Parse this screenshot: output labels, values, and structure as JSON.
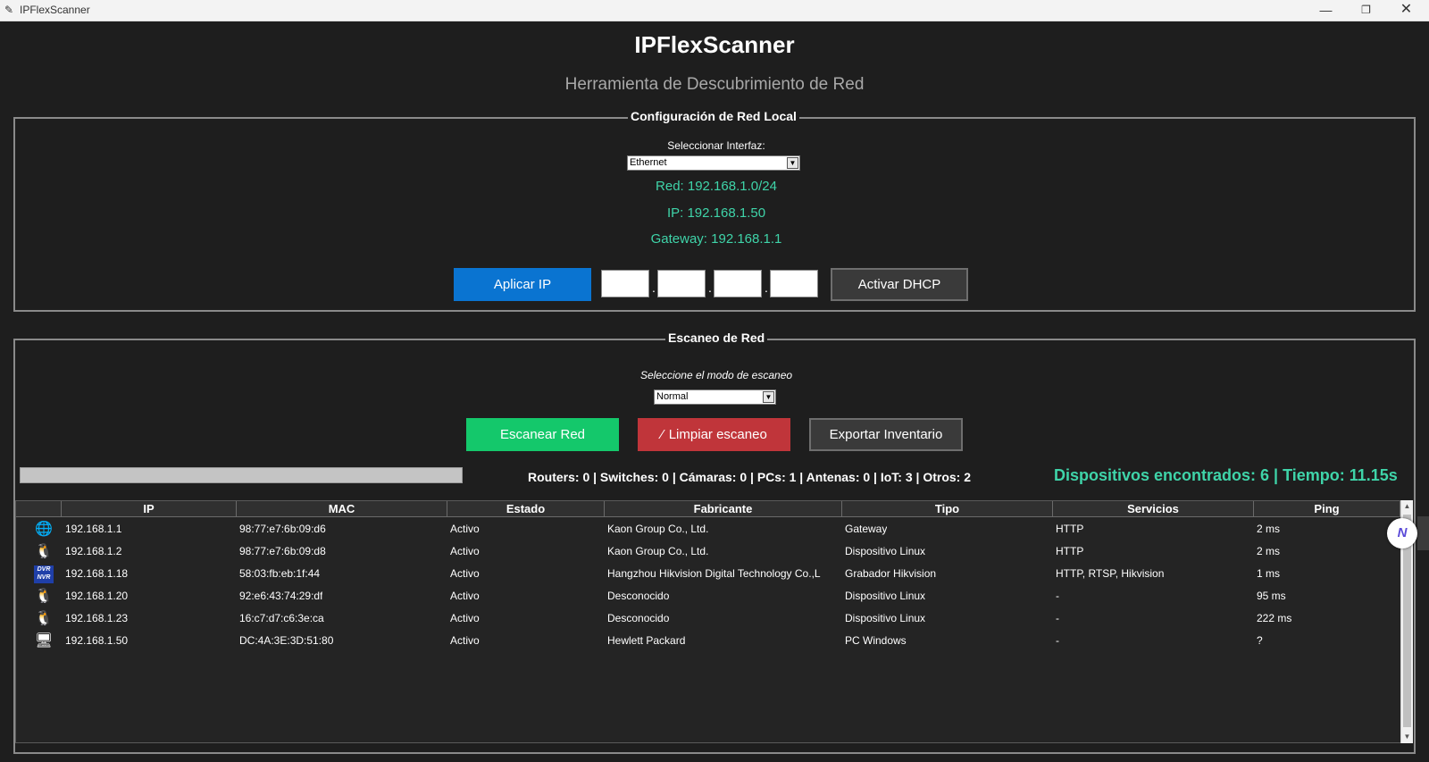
{
  "window": {
    "title": "IPFlexScanner",
    "controls": {
      "minimize": "—",
      "maximize": "❐",
      "close": "✕"
    }
  },
  "header": {
    "title": "IPFlexScanner",
    "subtitle": "Herramienta de Descubrimiento de Red"
  },
  "config": {
    "legend": "Configuración de Red Local",
    "interface_label": "Seleccionar Interfaz:",
    "interface_value": "Ethernet",
    "network": "Red: 192.168.1.0/24",
    "ip": "IP: 192.168.1.50",
    "gateway": "Gateway: 192.168.1.1",
    "apply_ip_label": "Aplicar IP",
    "ip_octets": [
      "",
      "",
      "",
      ""
    ],
    "dhcp_label": "Activar DHCP"
  },
  "scan": {
    "legend": "Escaneo de Red",
    "mode_label": "Seleccione el modo de escaneo",
    "mode_value": "Normal",
    "scan_label": "Escanear Red",
    "clear_label": "Limpiar escaneo",
    "export_label": "Exportar Inventario",
    "counts": "Routers: 0 | Switches: 0 | Cámaras: 0 | PCs: 1 | Antenas: 0 | IoT: 3 | Otros: 2",
    "found": "Dispositivos encontrados: 6 | Tiempo: 11.15s"
  },
  "table": {
    "columns": [
      "",
      "IP",
      "MAC",
      "Estado",
      "Fabricante",
      "Tipo",
      "Servicios",
      "Ping"
    ],
    "rows": [
      {
        "icon": "globe-icon",
        "ip": "192.168.1.1",
        "mac": "98:77:e7:6b:09:d6",
        "estado": "Activo",
        "fabricante": "Kaon Group Co., Ltd.",
        "tipo": "Gateway",
        "servicios": "HTTP",
        "ping": "2 ms"
      },
      {
        "icon": "linux-icon",
        "ip": "192.168.1.2",
        "mac": "98:77:e7:6b:09:d8",
        "estado": "Activo",
        "fabricante": "Kaon Group Co., Ltd.",
        "tipo": "Dispositivo Linux",
        "servicios": "HTTP",
        "ping": "2 ms"
      },
      {
        "icon": "dvr-nvr-icon",
        "ip": "192.168.1.18",
        "mac": "58:03:fb:eb:1f:44",
        "estado": "Activo",
        "fabricante": "Hangzhou Hikvision Digital Technology Co.,L",
        "tipo": "Grabador Hikvision",
        "servicios": "HTTP, RTSP, Hikvision",
        "ping": "1 ms"
      },
      {
        "icon": "linux-icon",
        "ip": "192.168.1.20",
        "mac": "92:e6:43:74:29:df",
        "estado": "Activo",
        "fabricante": "Desconocido",
        "tipo": "Dispositivo Linux",
        "servicios": "-",
        "ping": "95 ms"
      },
      {
        "icon": "linux-icon",
        "ip": "192.168.1.23",
        "mac": "16:c7:d7:c6:3e:ca",
        "estado": "Activo",
        "fabricante": "Desconocido",
        "tipo": "Dispositivo Linux",
        "servicios": "-",
        "ping": "222 ms"
      },
      {
        "icon": "pc-icon",
        "ip": "192.168.1.50",
        "mac": "DC:4A:3E:3D:51:80",
        "estado": "Activo",
        "fabricante": "Hewlett Packard",
        "tipo": "PC Windows",
        "servicios": "-",
        "ping": "?"
      }
    ]
  },
  "dvr_badge": {
    "top": "DVR",
    "bottom": "NVR"
  },
  "colors": {
    "accent_green": "#3fd4a9",
    "btn_blue": "#0a74d1",
    "btn_green": "#14c86b",
    "btn_red": "#c0353a",
    "background": "#1e1e1e"
  },
  "progress": {
    "value": 0
  }
}
